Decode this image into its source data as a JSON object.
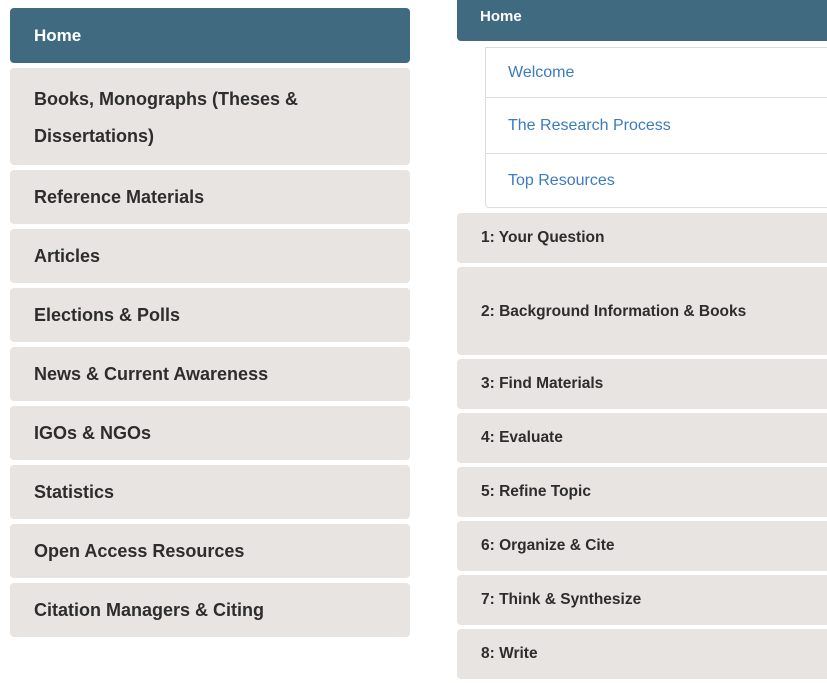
{
  "left_nav": {
    "items": [
      {
        "label": "Home",
        "active": true
      },
      {
        "label": "Books, Monographs (Theses & Dissertations)",
        "active": false
      },
      {
        "label": "Reference Materials",
        "active": false
      },
      {
        "label": "Articles",
        "active": false
      },
      {
        "label": "Elections & Polls",
        "active": false
      },
      {
        "label": "News & Current Awareness",
        "active": false
      },
      {
        "label": "IGOs & NGOs",
        "active": false
      },
      {
        "label": "Statistics",
        "active": false
      },
      {
        "label": "Open Access Resources",
        "active": false
      },
      {
        "label": "Citation Managers & Citing",
        "active": false
      }
    ]
  },
  "right_nav": {
    "home_label": "Home",
    "sub_items": [
      {
        "label": "Welcome"
      },
      {
        "label": "The Research Process"
      },
      {
        "label": "Top Resources"
      }
    ],
    "items": [
      {
        "label": "1: Your Question"
      },
      {
        "label": "2: Background Information & Books"
      },
      {
        "label": "3: Find Materials"
      },
      {
        "label": "4: Evaluate"
      },
      {
        "label": "5: Refine Topic"
      },
      {
        "label": "6: Organize & Cite"
      },
      {
        "label": "7: Think & Synthesize"
      },
      {
        "label": "8: Write"
      }
    ]
  },
  "colors": {
    "active_bg": "#3f6a80",
    "item_bg": "#e8e4e1",
    "link": "#3b7bbf"
  }
}
